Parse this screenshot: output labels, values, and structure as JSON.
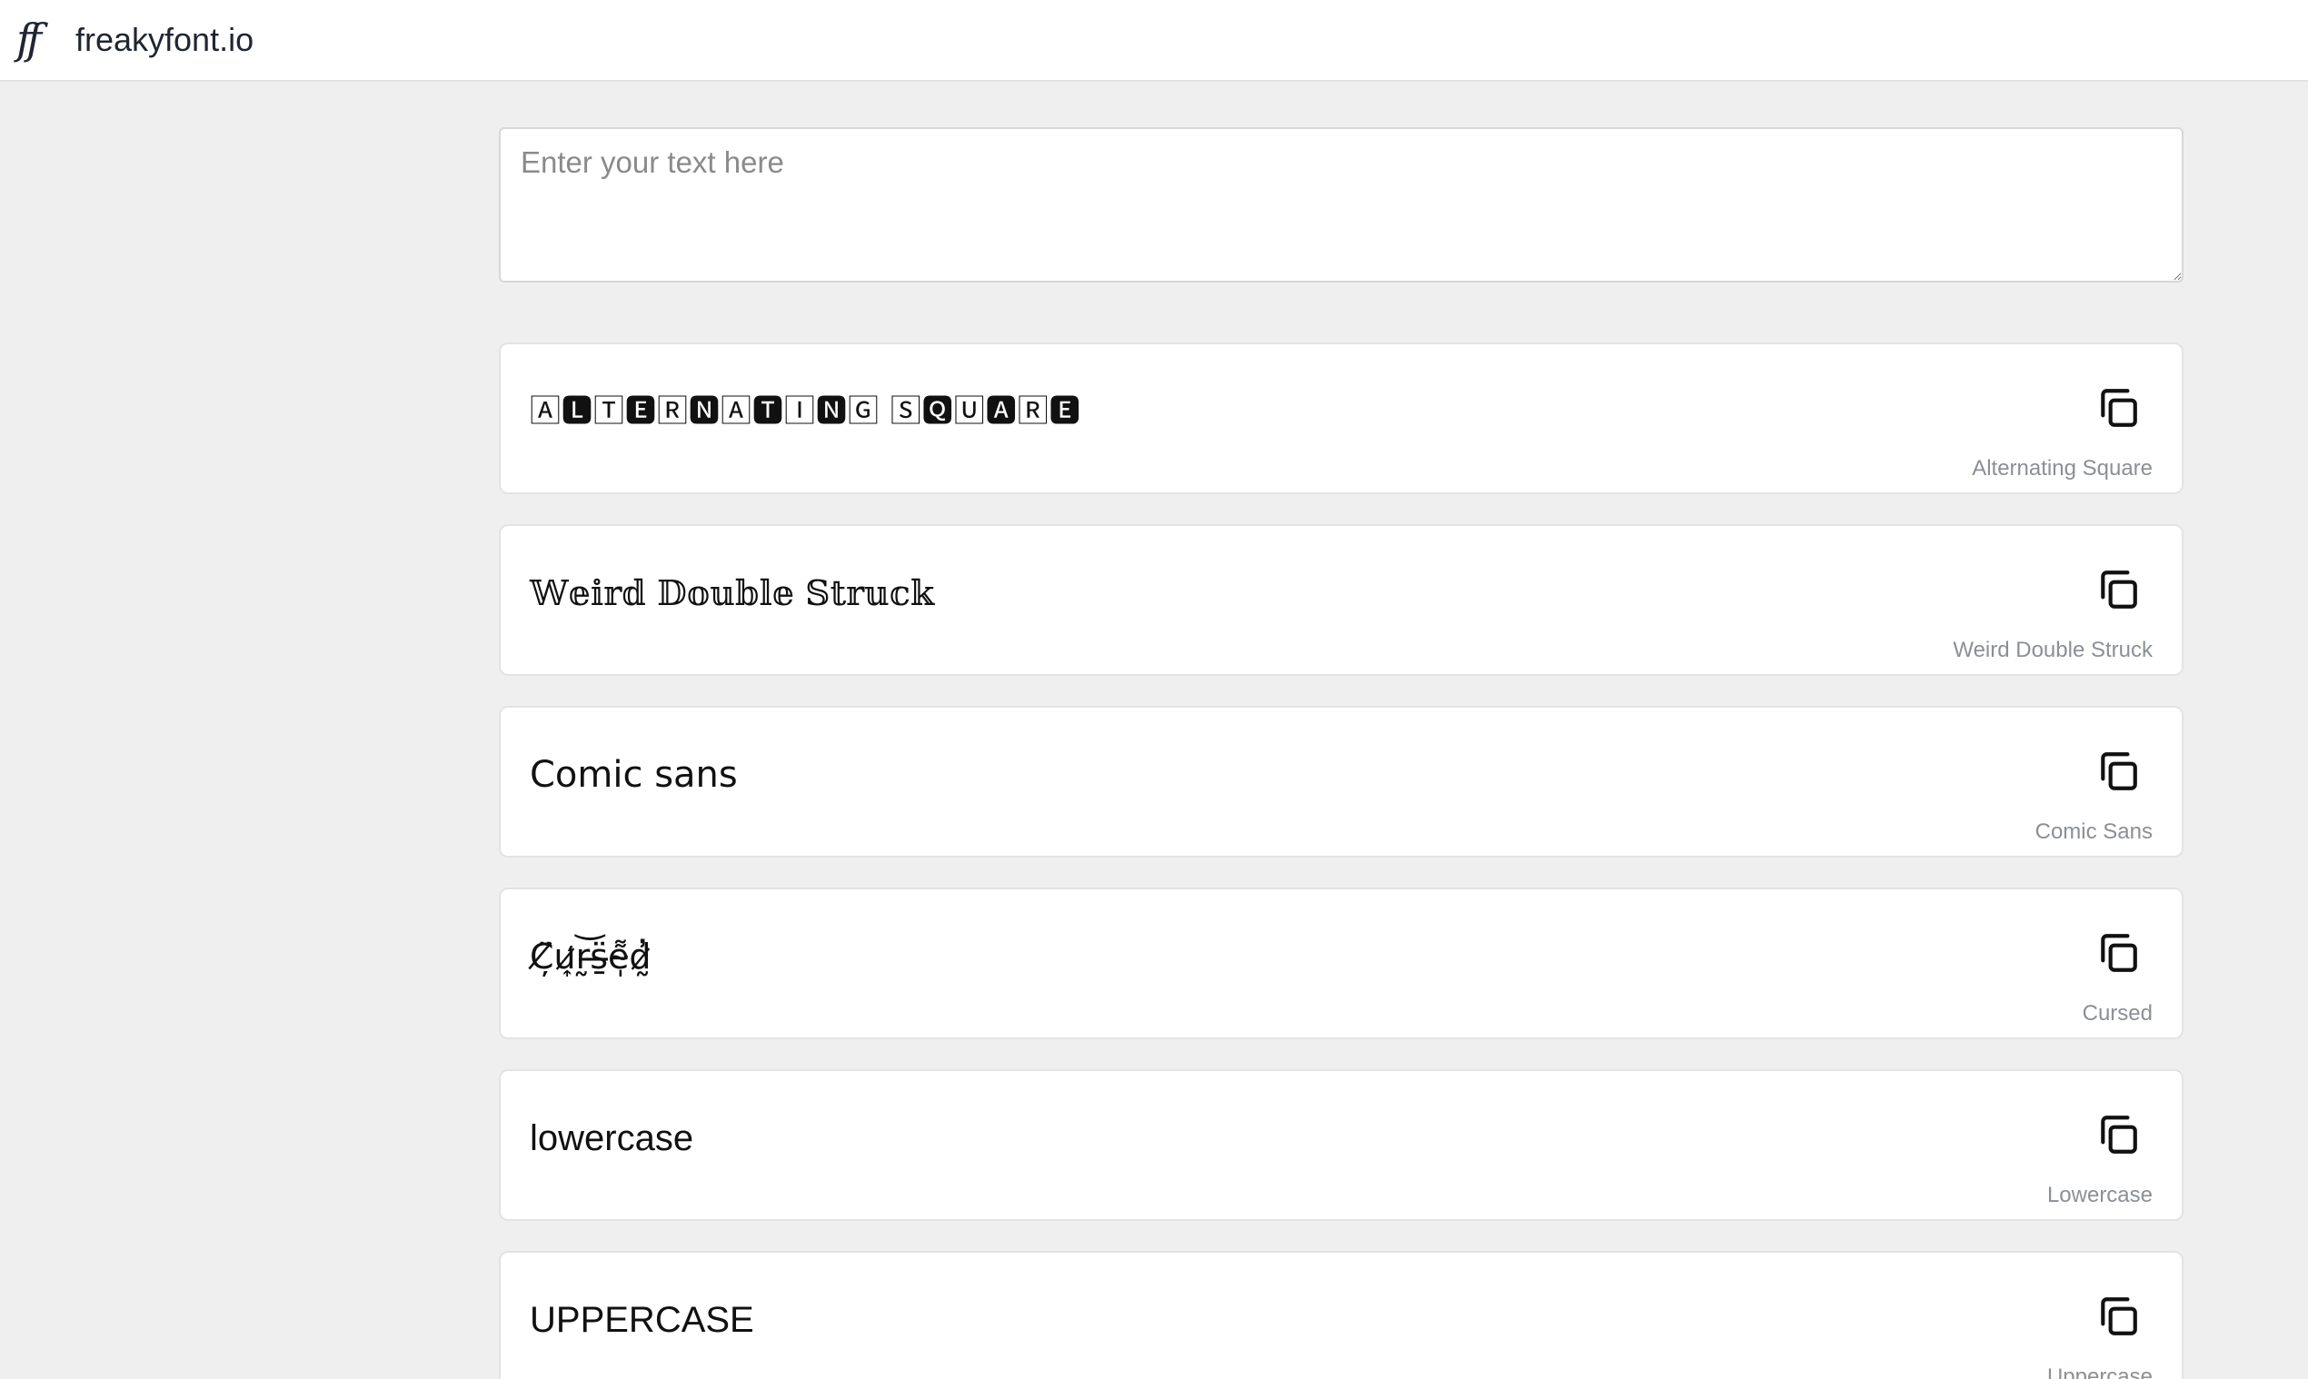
{
  "header": {
    "logo_glyph": "ff",
    "site_name": "freakyfont.io"
  },
  "input": {
    "placeholder": "Enter your text here",
    "value": ""
  },
  "cards": [
    {
      "preview": "🄰🅻🅃🅴🅁🅽🄰🆃🄸🅽🄶 🅂🆀🅄🅰🅁🅴",
      "label": "Alternating Square",
      "copy_icon": "copy-icon"
    },
    {
      "preview": "𝕎𝕖𝕚𝕣𝕕 𝔻𝕠𝕦𝕓𝕝𝕖 𝕊𝕥𝕣𝕦𝕔𝕜",
      "label": "Weird Double Struck",
      "copy_icon": "copy-icon"
    },
    {
      "preview": "Comic sans",
      "label": "Comic Sans",
      "copy_icon": "copy-icon"
    },
    {
      "preview": "C̸̦̈u̷͎̒r̵̰͝s̶̱̈e̴̩͌d̷̰̓",
      "label": "Cursed",
      "copy_icon": "copy-icon"
    },
    {
      "preview": "lowercase",
      "label": "Lowercase",
      "copy_icon": "copy-icon"
    },
    {
      "preview": "UPPERCASE",
      "label": "Uppercase",
      "copy_icon": "copy-icon"
    }
  ]
}
